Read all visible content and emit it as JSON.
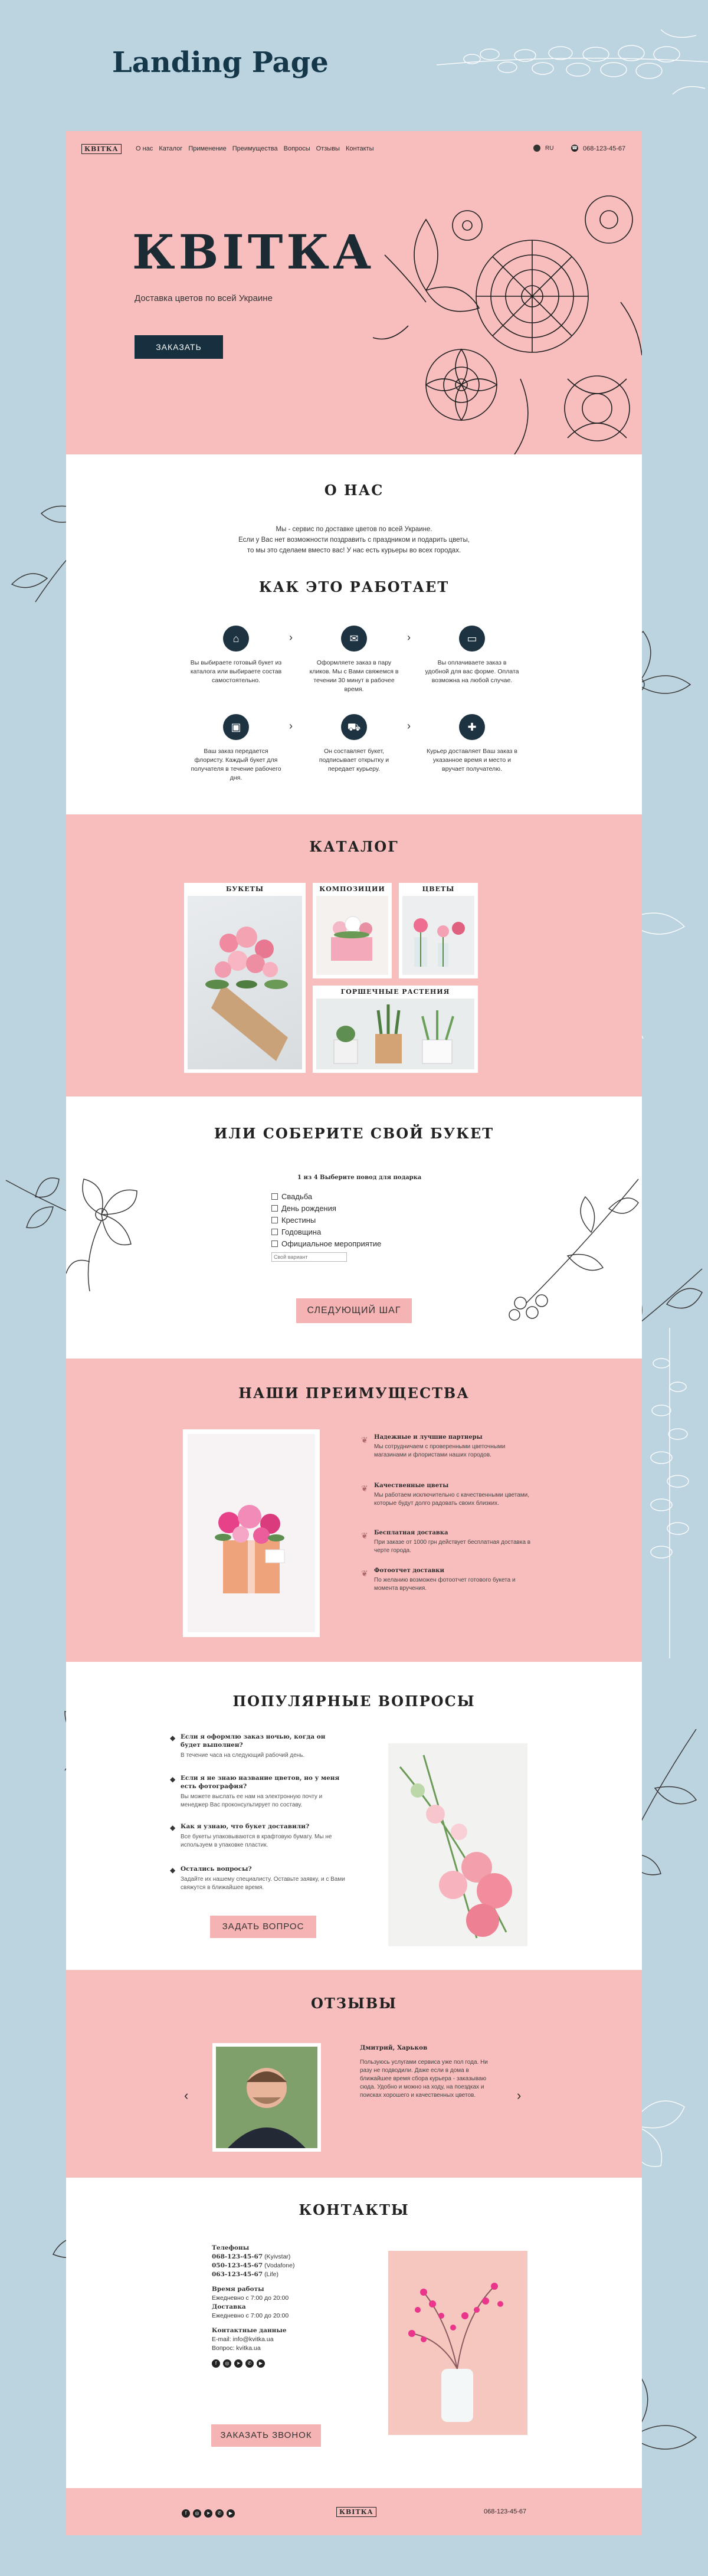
{
  "presentation_title": "Landing Page",
  "nav": {
    "logo": "КВІТКА",
    "links": [
      "О нас",
      "Каталог",
      "Применение",
      "Преимущества",
      "Вопросы",
      "Отзывы",
      "Контакты"
    ],
    "lang": "RU",
    "phone": "068-123-45-67"
  },
  "hero": {
    "title": "КВІТКА",
    "subtitle": "Доставка цветов по всей Украине",
    "button": "ЗАКАЗАТЬ"
  },
  "about": {
    "title": "О НАС",
    "text": [
      "Мы - сервис по доставке цветов по всей Украине.",
      "Если у Вас нет возможности поздравить с праздником и подарить цветы,",
      "то мы это сделаем вместо вас! У нас есть курьеры во всех городах."
    ]
  },
  "how": {
    "title": "КАК ЭТО РАБОТАЕТ",
    "steps": [
      {
        "icon": "shop-icon",
        "text": "Вы выбираете готовый букет из каталога или выбираете состав самостоятельно."
      },
      {
        "icon": "chat-icon",
        "text": "Оформляете заказ в пару кликов. Мы с Вами свяжемся в течении 30 минут в рабочее время."
      },
      {
        "icon": "card-icon",
        "text": "Вы оплачиваете заказ в удобной для вас форме. Оплата возможна на любой случае."
      },
      {
        "icon": "bag-icon",
        "text": "Ваш заказ передается флористу. Каждый букет для получателя в течение рабочего дня."
      },
      {
        "icon": "truck-icon",
        "text": "Он составляет букет, подписывает открытку и передает курьеру."
      },
      {
        "icon": "gift-icon",
        "text": "Курьер доставляет Ваш заказ в указанное время и место и вручает получателю."
      }
    ]
  },
  "catalog": {
    "title": "КАТАЛОГ",
    "items": [
      "БУКЕТЫ",
      "КОМПОЗИЦИИ",
      "ЦВЕТЫ",
      "ГОРШЕЧНЫЕ РАСТЕНИЯ"
    ]
  },
  "builder": {
    "title": "ИЛИ СОБЕРИТЕ СВОЙ БУКЕТ",
    "step": "1 из 4 Выберите повод для подарка",
    "options": [
      "Свадьба",
      "День рождения",
      "Крестины",
      "Годовщина",
      "Официальное мероприятие"
    ],
    "input_placeholder": "Свой вариант",
    "button": "СЛЕДУЮЩИЙ ШАГ"
  },
  "advantages": {
    "title": "НАШИ ПРЕИМУЩЕСТВА",
    "items": [
      {
        "title": "Надежные и лучшие партнеры",
        "text": "Мы сотрудничаем с проверенными цветочными магазинами и флористами наших городов."
      },
      {
        "title": "Качественные цветы",
        "text": "Мы работаем исключительно с качественными цветами, которые будут долго радовать своих близких."
      },
      {
        "title": "Бесплатная доставка",
        "text": "При заказе от 1000 грн действует бесплатная доставка в черте города."
      },
      {
        "title": "Фотоотчет доставки",
        "text": "По желанию возможен фотоотчет готового букета и момента вручения."
      }
    ]
  },
  "faq": {
    "title": "ПОПУЛЯРНЫЕ ВОПРОСЫ",
    "items": [
      {
        "q": "Если я оформлю заказ ночью, когда он будет выполнен?",
        "a": "В течение часа на следующий рабочий день."
      },
      {
        "q": "Если я не знаю название цветов, но у меня есть фотография?",
        "a": "Вы можете выслать ее нам на электронную почту и менеджер Вас проконсультирует по составу."
      },
      {
        "q": "Как я узнаю, что букет доставили?",
        "a": "Все букеты упаковываются в крафтовую бумагу. Мы не используем в упаковке пластик."
      },
      {
        "q": "Остались вопросы?",
        "a": "Задайте их нашему специалисту. Оставьте заявку, и с Вами свяжутся в ближайшее время."
      }
    ],
    "button": "ЗАДАТЬ ВОПРОС"
  },
  "reviews": {
    "title": "ОТЗЫВЫ",
    "author": "Дмитрий, Харьков",
    "text": "Пользуюсь услугами сервиса уже пол года. Ни разу не подводили. Даже если в дома в ближайшее время сбора курьера - заказываю сюда. Удобно и можно на ходу, на поездках и поисках хорошего и качественных цветов."
  },
  "contacts": {
    "title": "КОНТАКТЫ",
    "phones_label": "Телефоны",
    "phones": [
      {
        "num": "068-123-45-67",
        "op": "(Kyivstar)"
      },
      {
        "num": "050-123-45-67",
        "op": "(Vodafone)"
      },
      {
        "num": "063-123-45-67",
        "op": "(Life)"
      }
    ],
    "hours_label": "Время работы",
    "hours": "Ежедневно с 7:00 до 20:00",
    "delivery_label": "Доставка",
    "delivery": "Ежедневно с 7:00 до 20:00",
    "extra_label": "Контактные данные",
    "email": "E-mail: info@kvitka.ua",
    "site": "Вопрос: kvitka.ua",
    "button": "ЗАКАЗАТЬ ЗВОНОК"
  },
  "footer": {
    "logo": "КВІТКА",
    "phone": "068-123-45-67"
  },
  "colors": {
    "pink": "#f8bebe",
    "navy": "#17303f",
    "bg": "#bcd3e0"
  }
}
